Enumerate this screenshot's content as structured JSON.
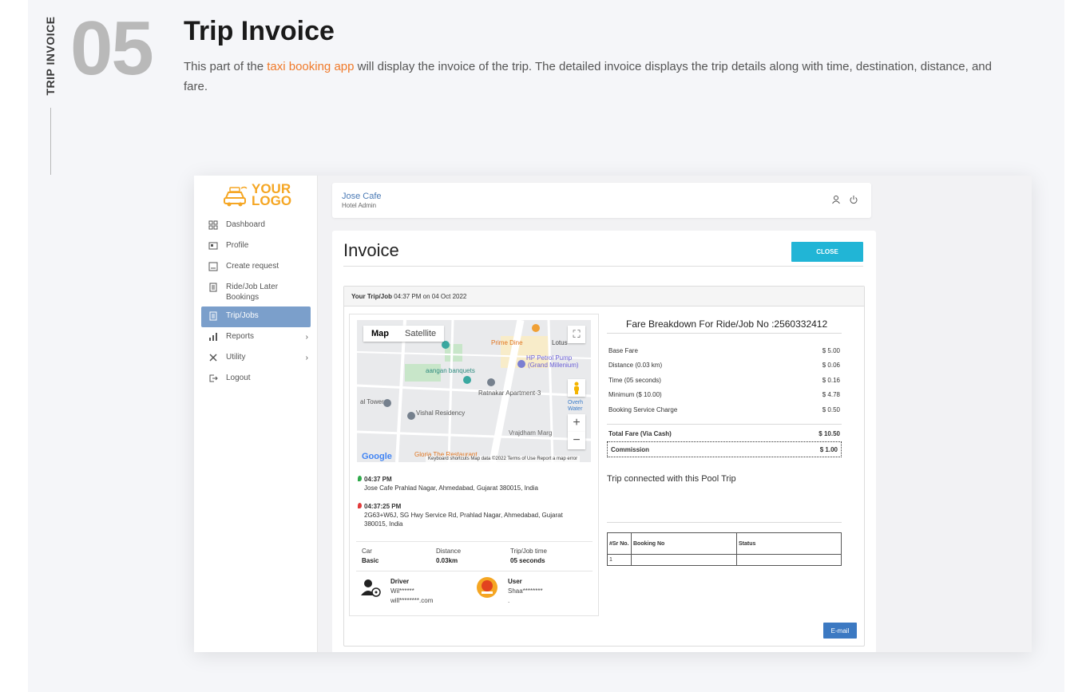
{
  "section": {
    "vertical_label": "TRIP INVOICE",
    "number": "05",
    "title": "Trip Invoice",
    "desc_before": "This part of the ",
    "desc_link": "taxi booking app",
    "desc_after": " will display the invoice of the trip. The detailed invoice displays the trip details along with time, destination, distance, and fare.",
    "accent_color": "#f07a2a"
  },
  "app": {
    "logo": {
      "line1": "YOUR",
      "line2": "LOGO",
      "color": "#f5a623"
    },
    "menu": [
      {
        "label": "Dashboard",
        "icon": "dashboard-icon"
      },
      {
        "label": "Profile",
        "icon": "profile-icon"
      },
      {
        "label": "Create request",
        "icon": "create-request-icon"
      },
      {
        "label": "Ride/Job Later Bookings",
        "icon": "bookings-icon"
      },
      {
        "label": "Trip/Jobs",
        "icon": "trip-icon",
        "active": true
      },
      {
        "label": "Reports",
        "icon": "reports-icon",
        "expandable": true
      },
      {
        "label": "Utility",
        "icon": "utility-icon",
        "expandable": true
      },
      {
        "label": "Logout",
        "icon": "logout-icon"
      }
    ],
    "topbar": {
      "name": "Jose Cafe",
      "role": "Hotel Admin"
    },
    "invoice": {
      "title": "Invoice",
      "close_label": "CLOSE",
      "trip_head_bold": "Your Trip/Job",
      "trip_head_rest": " 04:37 PM on 04 Oct 2022",
      "map": {
        "tab_map": "Map",
        "tab_satellite": "Satellite",
        "labels": [
          "Prime Dine",
          "HP Petrol Pump",
          "(Grand Millenium)",
          "aangan banquets",
          "Ratnakar Apartment-3",
          "Vishal Residency",
          "Vrajdham Marg",
          "Gloria The Restaurant",
          "Lotus",
          "al Tower",
          "Overh Water"
        ],
        "google": "Google",
        "footer": "Keyboard shortcuts    Map data ©2022    Terms of Use    Report a map error"
      },
      "pickup": {
        "time": "04:37 PM",
        "address": "Jose Cafe Prahlad Nagar, Ahmedabad, Gujarat 380015, India"
      },
      "dropoff": {
        "time": "04:37:25 PM",
        "address": "2G63+W6J, SG Hwy Service Rd, Prahlad Nagar, Ahmedabad, Gujarat 380015, India"
      },
      "stats": [
        {
          "label": "Car",
          "value": "Basic"
        },
        {
          "label": "Distance",
          "value": "0.03km"
        },
        {
          "label": "Trip/Job time",
          "value": "05 seconds"
        }
      ],
      "driver": {
        "title": "Driver",
        "name": "Wil******",
        "email": "will********.com"
      },
      "user": {
        "title": "User",
        "name": "Shaa********",
        "extra": "."
      },
      "fare": {
        "title": "Fare Breakdown For Ride/Job No :2560332412",
        "rows": [
          {
            "label": "Base Fare",
            "value": "$ 5.00"
          },
          {
            "label": "Distance (0.03 km)",
            "value": "$ 0.06"
          },
          {
            "label": "Time (05 seconds)",
            "value": "$ 0.16"
          },
          {
            "label": "Minimum ($ 10.00)",
            "value": "$ 4.78"
          },
          {
            "label": "Booking Service Charge",
            "value": "$ 0.50"
          }
        ],
        "total_label": "Total Fare (Via Cash)",
        "total_value": "$ 10.50",
        "commission_label": "Commission",
        "commission_value": "$ 1.00"
      },
      "pool_title": "Trip connected with this Pool Trip",
      "table": {
        "headers": [
          "#Sr No.",
          "Booking No",
          "Status"
        ],
        "rows": [
          [
            "1",
            "",
            ""
          ]
        ]
      },
      "email_label": "E-mail"
    }
  }
}
